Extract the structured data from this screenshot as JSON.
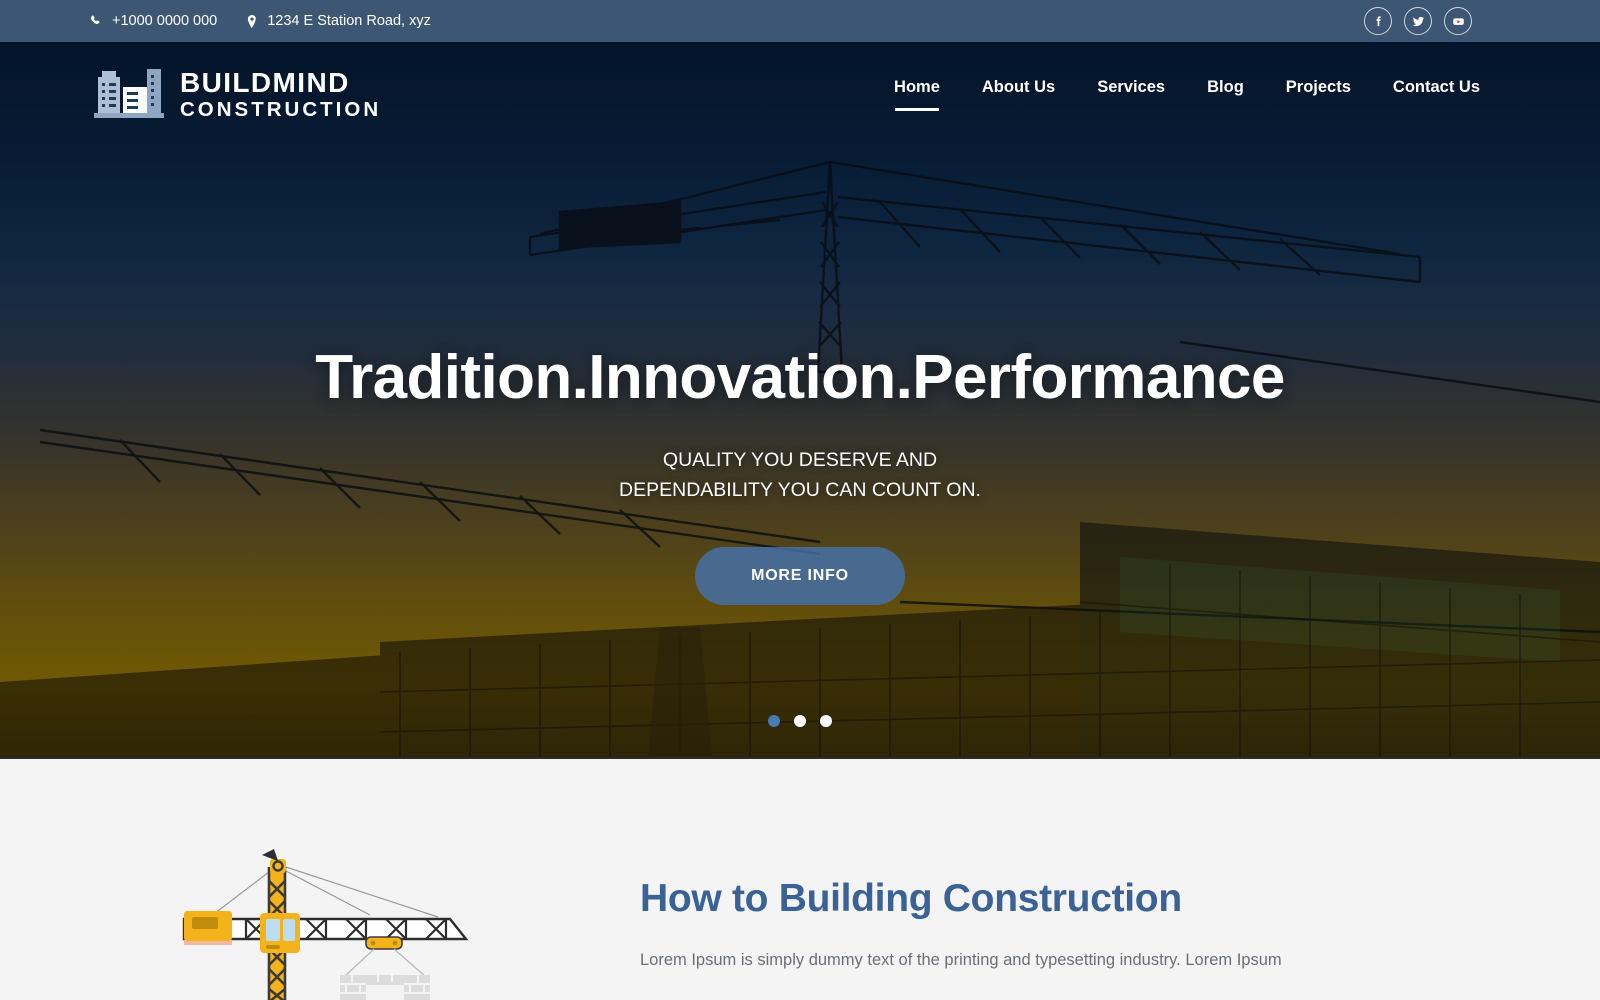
{
  "topbar": {
    "phone": "+1000 0000 000",
    "phone_icon": "phone-icon",
    "address": "1234 E Station Road, xyz",
    "address_icon": "map-pin-icon",
    "bg_color": "#3d5674",
    "socials": [
      {
        "name": "facebook",
        "glyph": "f"
      },
      {
        "name": "twitter",
        "glyph": "t"
      },
      {
        "name": "youtube",
        "glyph": "y"
      }
    ]
  },
  "header": {
    "logo": {
      "icon": "buildings-icon",
      "line1": "BUILDMIND",
      "line2": "CONSTRUCTION"
    },
    "nav": [
      {
        "label": "Home",
        "active": true
      },
      {
        "label": "About Us",
        "active": false
      },
      {
        "label": "Services",
        "active": false
      },
      {
        "label": "Blog",
        "active": false
      },
      {
        "label": "Projects",
        "active": false
      },
      {
        "label": "Contact Us",
        "active": false
      }
    ]
  },
  "hero": {
    "title": "Tradition.Innovation.Performance",
    "subtitle_line1": "QUALITY YOU DESERVE AND",
    "subtitle_line2": "DEPENDABILITY YOU CAN COUNT ON.",
    "cta_label": "MORE INFO",
    "cta_color": "#4672ac",
    "slides": [
      {
        "active": true
      },
      {
        "active": false
      },
      {
        "active": false
      }
    ],
    "background": "construction-site-cranes-sunset-photo"
  },
  "about": {
    "illustration": "tower-crane-illustration",
    "heading": "How to Building Construction",
    "heading_color": "#3a6294",
    "paragraph": "Lorem Ipsum is simply dummy text of the printing and typesetting industry. Lorem Ipsum"
  }
}
